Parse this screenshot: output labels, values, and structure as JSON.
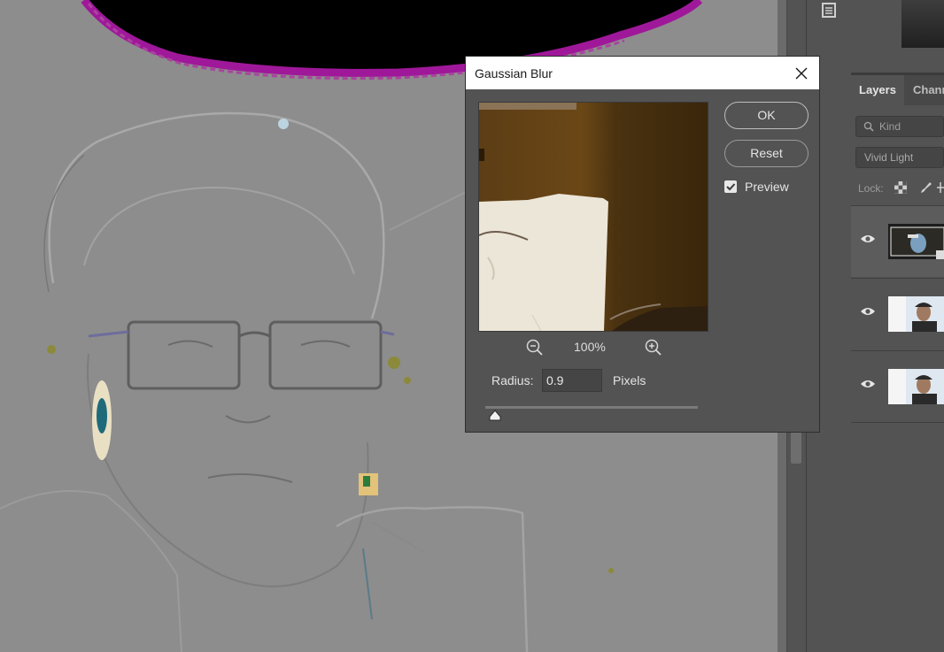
{
  "dialog": {
    "title": "Gaussian Blur",
    "ok_label": "OK",
    "reset_label": "Reset",
    "preview_label": "Preview",
    "preview_checked": true,
    "zoom_level": "100%",
    "radius_label": "Radius:",
    "radius_value": "0.9",
    "radius_unit": "Pixels"
  },
  "layers_panel": {
    "tabs": [
      {
        "label": "Layers",
        "active": true
      },
      {
        "label": "Channels",
        "active": false
      }
    ],
    "filter_placeholder": "Kind",
    "blend_mode": "Vivid Light",
    "lock_label": "Lock:",
    "layers": [
      {
        "selected": true,
        "visible": true
      },
      {
        "selected": false,
        "visible": true
      },
      {
        "selected": false,
        "visible": true
      }
    ]
  },
  "colors": {
    "canvas": "#8c8c8c",
    "panel": "#535353",
    "dialog_title_bg": "#ffffff"
  }
}
